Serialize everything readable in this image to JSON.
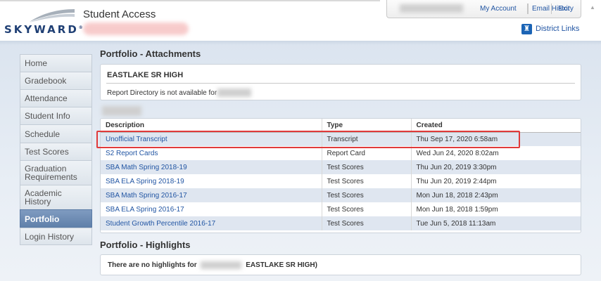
{
  "header": {
    "app_title": "Student Access",
    "logo_text": "SKYWARD",
    "logo_mark": "®",
    "account_links": [
      "My Account",
      "Email History",
      "Exit"
    ],
    "district_links": "District Links"
  },
  "sidebar": {
    "items": [
      {
        "label": "Home",
        "active": false
      },
      {
        "label": "Gradebook",
        "active": false
      },
      {
        "label": "Attendance",
        "active": false
      },
      {
        "label": "Student Info",
        "active": false
      },
      {
        "label": "Schedule",
        "active": false
      },
      {
        "label": "Test Scores",
        "active": false
      },
      {
        "label": "Graduation Requirements",
        "active": false
      },
      {
        "label": "Academic History",
        "active": false
      },
      {
        "label": "Portfolio",
        "active": true
      },
      {
        "label": "Login History",
        "active": false
      }
    ]
  },
  "attachments": {
    "title": "Portfolio - Attachments",
    "school": "EASTLAKE SR HIGH",
    "report_message": "Report Directory is not available for",
    "columns": [
      "Description",
      "Type",
      "Created"
    ],
    "rows": [
      {
        "description": "Unofficial Transcript",
        "type": "Transcript",
        "created": "Thu Sep 17, 2020 6:58am"
      },
      {
        "description": "S2 Report Cards",
        "type": "Report Card",
        "created": "Wed Jun 24, 2020 8:02am"
      },
      {
        "description": "SBA Math Spring 2018-19",
        "type": "Test Scores",
        "created": "Thu Jun 20, 2019 3:30pm"
      },
      {
        "description": "SBA ELA Spring 2018-19",
        "type": "Test Scores",
        "created": "Thu Jun 20, 2019 2:44pm"
      },
      {
        "description": "SBA Math Spring 2016-17",
        "type": "Test Scores",
        "created": "Mon Jun 18, 2018 2:43pm"
      },
      {
        "description": "SBA ELA Spring 2016-17",
        "type": "Test Scores",
        "created": "Mon Jun 18, 2018 1:59pm"
      },
      {
        "description": "Student Growth Percentile 2016-17",
        "type": "Test Scores",
        "created": "Tue Jun 5, 2018 11:13am"
      }
    ]
  },
  "highlights": {
    "title": "Portfolio - Highlights",
    "message_prefix": "There are no highlights for",
    "message_suffix": "EASTLAKE SR HIGH)"
  },
  "colors": {
    "link": "#2155a3",
    "active_nav": "#6f8db6",
    "row_stripe": "#dfe6f0",
    "highlight_outline": "#e03a3a",
    "brand": "#1f3f74"
  }
}
